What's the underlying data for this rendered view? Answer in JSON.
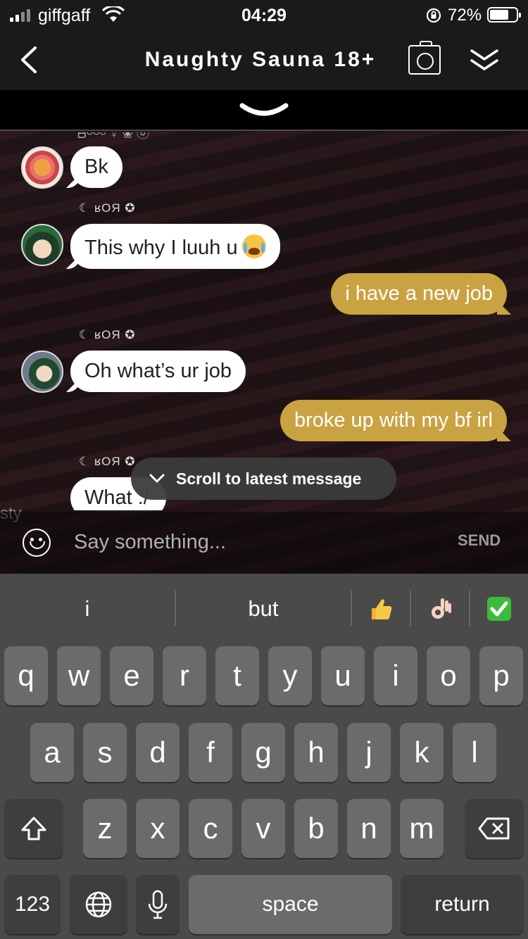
{
  "status_bar": {
    "carrier": "giffgaff",
    "time": "04:29",
    "battery": "72%",
    "battery_level": 0.72
  },
  "header": {
    "title": "Naughty Sauna 18+"
  },
  "chat": {
    "truncated_name": "ᗷᴼᴼᴳ ♀ ❀ ⓞ",
    "messages": [
      {
        "type": "incoming",
        "sender": "",
        "text": "Bk"
      },
      {
        "type": "incoming",
        "sender": "☾ ʁOЯ ✪",
        "text": "This why I luuh u"
      },
      {
        "type": "outgoing",
        "text": "i have a new job"
      },
      {
        "type": "incoming",
        "sender": "☾ ʁOЯ ✪",
        "text": "Oh what’s ur job"
      },
      {
        "type": "outgoing",
        "text": "broke up with my bf irl"
      },
      {
        "type": "incoming",
        "sender": "☾ ʁOЯ ✪",
        "text": "What :/"
      }
    ],
    "scroll_to_latest": "Scroll to latest message",
    "side_text": "sty"
  },
  "input": {
    "placeholder": "Say something...",
    "send_label": "SEND"
  },
  "keyboard": {
    "suggestions": [
      "i",
      "but"
    ],
    "suggestion_emojis": [
      "thumbs-up-emoji",
      "ok-hand-emoji",
      "check-mark-emoji"
    ],
    "row1": [
      "q",
      "w",
      "e",
      "r",
      "t",
      "y",
      "u",
      "i",
      "o",
      "p"
    ],
    "row2": [
      "a",
      "s",
      "d",
      "f",
      "g",
      "h",
      "j",
      "k",
      "l"
    ],
    "row3": [
      "z",
      "x",
      "c",
      "v",
      "b",
      "n",
      "m"
    ],
    "numbers_label": "123",
    "space_label": "space",
    "return_label": "return"
  },
  "colors": {
    "accent": "#c9a242",
    "bubble_in": "#ffffff",
    "header_bg": "#1a1a1a",
    "keyboard_bg": "#4a4a4a"
  }
}
